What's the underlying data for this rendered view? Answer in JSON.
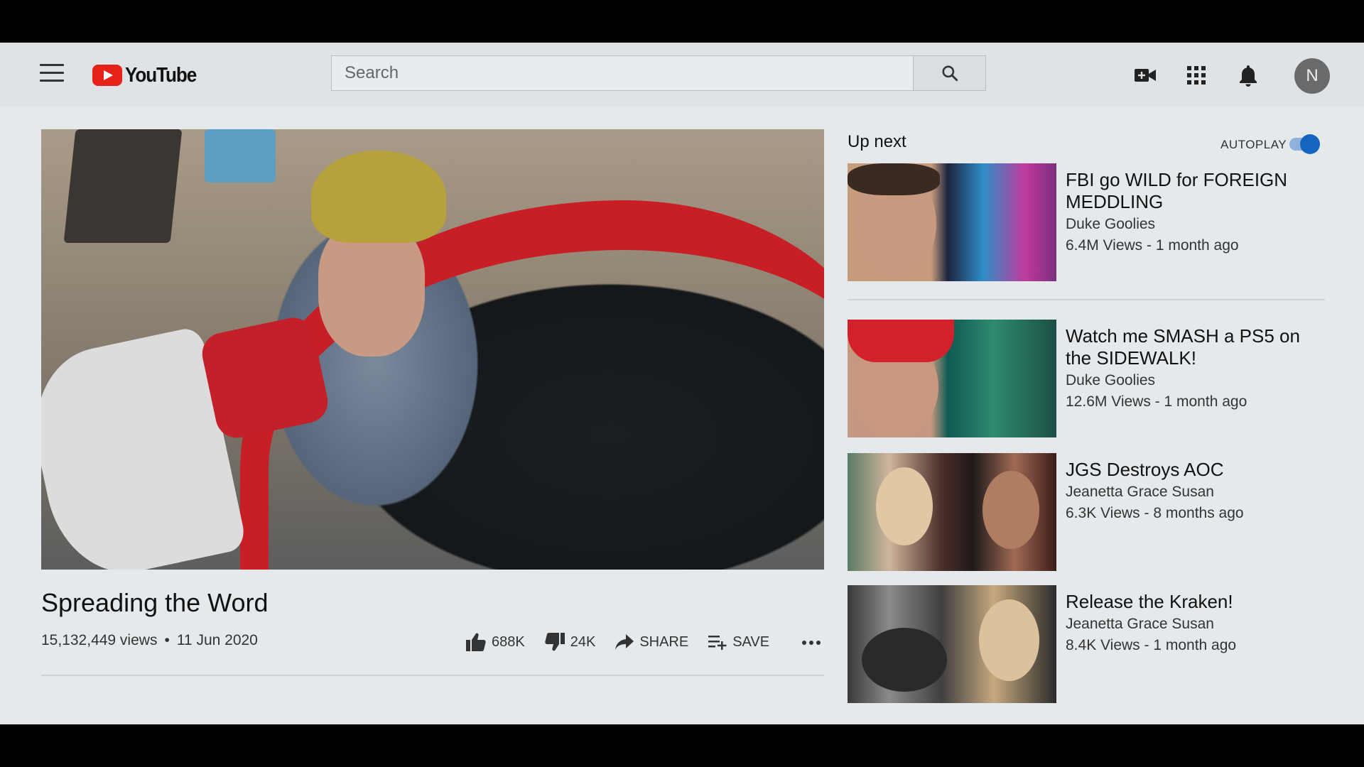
{
  "header": {
    "logo_text": "YouTube",
    "search_placeholder": "Search",
    "search_value": "",
    "avatar_initial": "N",
    "icons": [
      "menu-icon",
      "youtube-logo-icon",
      "search-icon",
      "create-video-icon",
      "apps-grid-icon",
      "bell-icon"
    ]
  },
  "video": {
    "title": "Spreading the Word",
    "views": "15,132,449 views",
    "separator": "•",
    "date": "11 Jun 2020",
    "likes": "688K",
    "dislikes": "24K",
    "share_label": "SHARE",
    "save_label": "SAVE"
  },
  "sidebar": {
    "up_next_label": "Up next",
    "autoplay_label": "AUTOPLAY",
    "autoplay_on": true,
    "recommendations": [
      {
        "title": "FBI go WILD for FOREIGN MEDDLING",
        "channel": "Duke Goolies",
        "stats": "6.4M Views - 1 month ago"
      },
      {
        "title": "Watch me SMASH a PS5 on the SIDEWALK!",
        "channel": "Duke Goolies",
        "stats": "12.6M Views - 1 month ago"
      },
      {
        "title": "JGS Destroys AOC",
        "channel": "Jeanetta Grace Susan",
        "stats": "6.3K Views - 8 months ago"
      },
      {
        "title": "Release the Kraken!",
        "channel": "Jeanetta Grace Susan",
        "stats": "8.4K Views - 1 month ago"
      }
    ]
  },
  "colors": {
    "brand_red": "#e62117",
    "toggle_blue": "#1565c0",
    "background": "#e6e9eb"
  }
}
